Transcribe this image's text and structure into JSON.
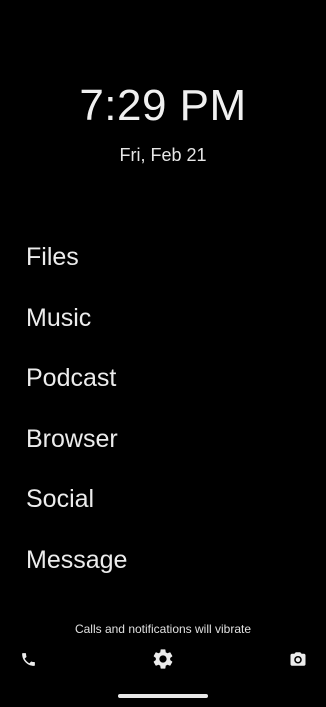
{
  "lockscreen": {
    "time": "7:29 PM",
    "date": "Fri, Feb 21",
    "notice": "Calls and notifications will vibrate"
  },
  "apps": [
    {
      "label": "Files"
    },
    {
      "label": "Music"
    },
    {
      "label": "Podcast"
    },
    {
      "label": "Browser"
    },
    {
      "label": "Social"
    },
    {
      "label": "Message"
    }
  ],
  "shortcuts": {
    "left": "phone-icon",
    "center": "settings-gear-icon",
    "right": "camera-icon"
  },
  "colors": {
    "background": "#000000",
    "foreground": "#ececec"
  }
}
